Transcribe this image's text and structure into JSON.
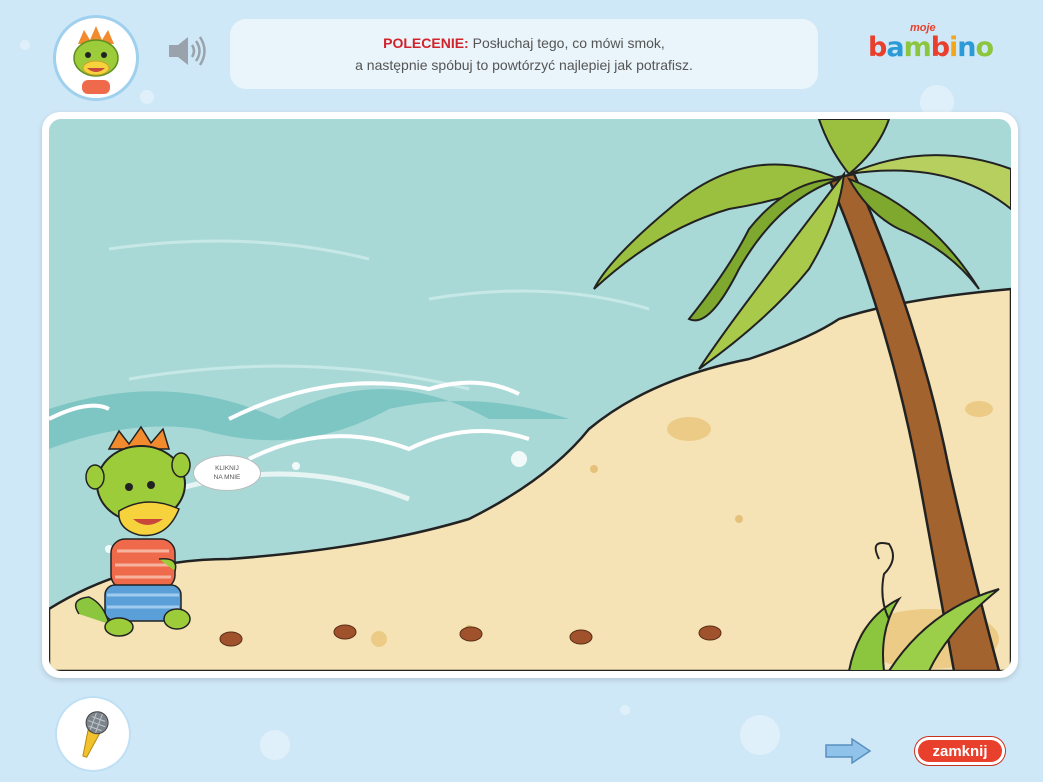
{
  "header": {
    "instruction_label": "POLECENIE:",
    "instruction_line1": "Posłuchaj tego, co mówi smok,",
    "instruction_line2": "a następnie spóbuj to powtórzyć najlepiej jak potrafisz."
  },
  "logo": {
    "small_text": "moje",
    "brand_letters": [
      "b",
      "a",
      "m",
      "b",
      "i",
      "n",
      "o"
    ],
    "brand_colors": [
      "#e8402d",
      "#2b9ad6",
      "#8cc63f",
      "#e8402d",
      "#f2a71b",
      "#2b9ad6",
      "#8cc63f"
    ]
  },
  "scene": {
    "speech_line1": "KLIKNIJ",
    "speech_line2": "NA MNIE"
  },
  "footer": {
    "close_label": "zamknij"
  },
  "icons": {
    "avatar": "dragon-avatar-icon",
    "speaker": "speaker-icon",
    "microphone": "microphone-icon",
    "next": "arrow-right-icon"
  },
  "colors": {
    "background": "#cfe8f7",
    "sea": "#a9d9d6",
    "sand": "#f5e3b6",
    "close_button": "#e8402d",
    "instruction_label": "#d2232a"
  }
}
